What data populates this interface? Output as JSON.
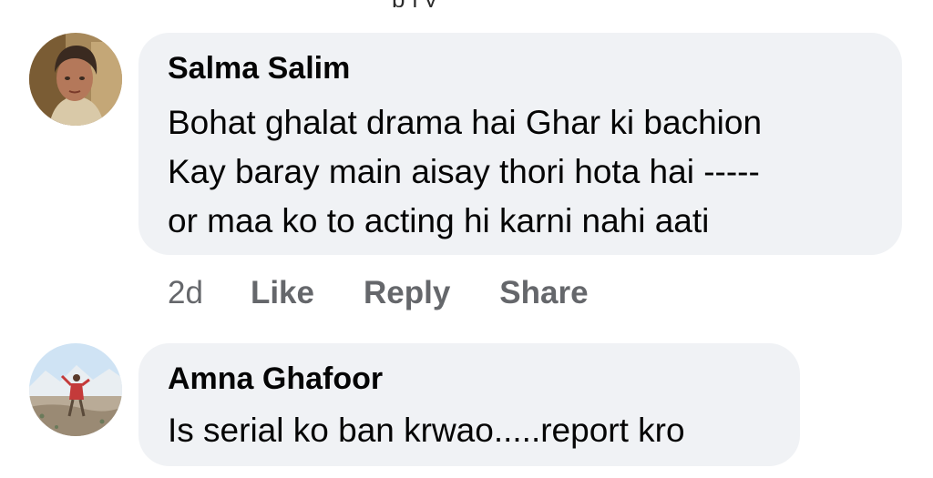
{
  "top_fragment": "ply",
  "comments": [
    {
      "author": "Salma Salim",
      "lines": [
        "Bohat ghalat drama hai Ghar ki bachion",
        "Kay baray main aisay thori hota hai -----",
        "or maa ko to acting hi karni nahi aati"
      ],
      "time": "2d",
      "actions": {
        "like": "Like",
        "reply": "Reply",
        "share": "Share"
      }
    },
    {
      "author": "Amna Ghafoor",
      "lines": [
        "Is serial ko ban krwao.....report kro"
      ]
    }
  ]
}
